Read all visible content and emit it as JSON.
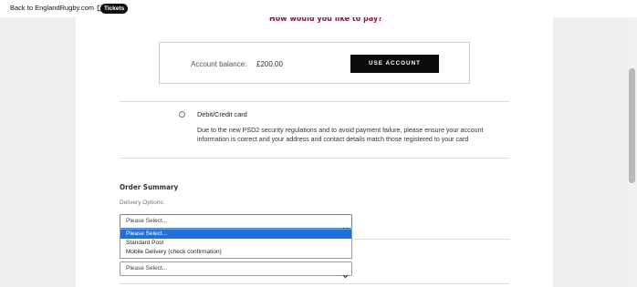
{
  "topbar": {
    "back_link": "Back to EnglandRugby.com",
    "tickets_badge": "Tickets"
  },
  "payment": {
    "title": "How would you like to pay?",
    "account_balance_label": "Account balance:",
    "account_balance_value": "£200.00",
    "use_account_button": "USE ACCOUNT",
    "card_option_label": "Debit/Credit card",
    "card_notice": "Due to the new PSD2 security regulations and to avoid payment failure, please ensure your account information is correct and your address and contact details match those registered to your card"
  },
  "order_summary": {
    "title": "Order Summary",
    "delivery_label": "Delivery Options:",
    "delivery_select_value": "Please Select...",
    "delivery_options": [
      "Please Select...",
      "Standard Post",
      "Mobile Delivery (check confirmation)"
    ],
    "second_select_value": "Please Select..."
  }
}
